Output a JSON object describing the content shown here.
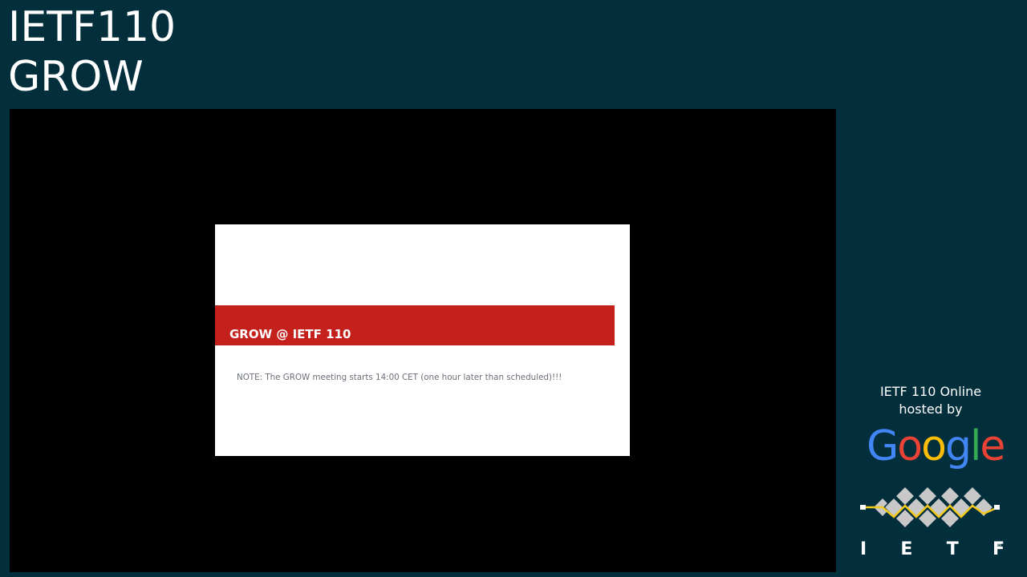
{
  "session": {
    "title_line1": "IETF110",
    "title_line2": "GROW"
  },
  "slide": {
    "heading": "GROW @ IETF 110",
    "note": "NOTE: The GROW meeting starts 14:00 CET (one hour later than scheduled)!!!"
  },
  "sponsor": {
    "line1": "IETF 110 Online",
    "line2": "hosted by",
    "logo_letters": [
      "G",
      "o",
      "o",
      "g",
      "l",
      "e"
    ],
    "logo_colors": [
      "#4285F4",
      "#EA4335",
      "#FBBC05",
      "#4285F4",
      "#34A853",
      "#EA4335"
    ]
  },
  "ietf_logo": {
    "letters": [
      "I",
      "E",
      "T",
      "F"
    ],
    "registered_mark": "®",
    "diamond_color": "#c8c8c8",
    "line_color": "#f2c81c"
  },
  "colors": {
    "background": "#032e3b",
    "banner": "#c4201c"
  }
}
